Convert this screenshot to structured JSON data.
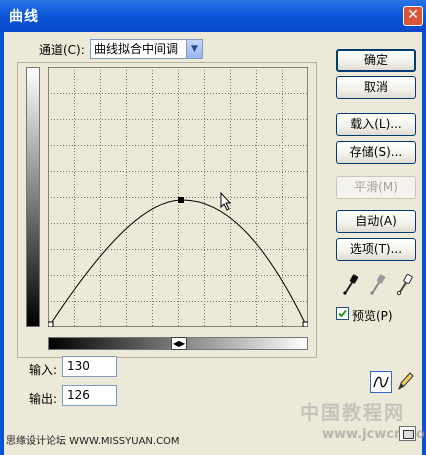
{
  "dialog": {
    "title": "曲线",
    "close_glyph": "✕"
  },
  "channel": {
    "label": "通道(C):",
    "value": "曲线拟合中间调"
  },
  "buttons": {
    "ok": "确定",
    "cancel": "取消",
    "load": "载入(L)...",
    "save": "存储(S)...",
    "smooth": "平滑(M)",
    "auto": "自动(A)",
    "options": "选项(T)..."
  },
  "preview": {
    "label": "预览(P)",
    "checked": true
  },
  "input": {
    "label": "输入:",
    "value": "130"
  },
  "output": {
    "label": "输出:",
    "value": "126"
  },
  "eyedroppers": [
    "black-eyedropper-icon",
    "gray-eyedropper-icon",
    "white-eyedropper-icon"
  ],
  "watermark": {
    "left": "思缘设计论坛 WWW.MISSYUAN.COM",
    "right_cn": "中国教程网",
    "right_url": "www.jcwcn.com"
  },
  "colors": {
    "title_bar": "#0a55d8",
    "dialog_bg": "#ece9d8",
    "button_border": "#003c74"
  }
}
